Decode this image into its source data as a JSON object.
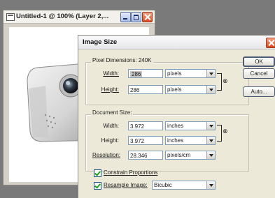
{
  "document_window": {
    "title": "Untitled-1 @ 100% (Layer 2,...",
    "image_alt": "camera"
  },
  "dialog": {
    "title": "Image Size",
    "pixel_dimensions": {
      "label": "Pixel Dimensions:",
      "size": "240K",
      "width_label": "Width:",
      "width_value": "286",
      "width_unit": "pixels",
      "height_label": "Height:",
      "height_value": "286",
      "height_unit": "pixels"
    },
    "document_size": {
      "label": "Document Size:",
      "width_label": "Width:",
      "width_value": "3.972",
      "width_unit": "inches",
      "height_label": "Height:",
      "height_value": "3.972",
      "height_unit": "inches",
      "resolution_label": "Resolution:",
      "resolution_value": "28.346",
      "resolution_unit": "pixels/cm"
    },
    "constrain_proportions": {
      "label": "Constrain Proportions",
      "checked": true
    },
    "resample_image": {
      "label": "Resample Image:",
      "checked": true,
      "method": "Bicubic"
    },
    "buttons": {
      "ok": "OK",
      "cancel": "Cancel",
      "auto": "Auto..."
    }
  }
}
